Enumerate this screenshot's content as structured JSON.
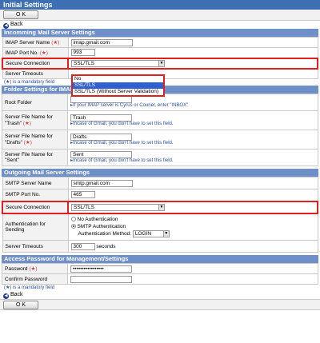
{
  "title": "Initial Settings",
  "ok_label": "O K",
  "back_label": "Back",
  "mandatory_note": "(★) is a mandatory field",
  "star": "(★)",
  "incoming": {
    "header": "Incomming Mail Server Settings",
    "imap_server_label": "IMAP Server Name",
    "imap_server_value": "imap.gmail.com",
    "imap_port_label": "IMAP Port No.",
    "imap_port_value": "993",
    "secure_label": "Secure Connection",
    "secure_value": "SSL/TLS",
    "secure_options": [
      "No",
      "SSL/TLS",
      "SSL/TLS (Without Server Validation)"
    ],
    "secure_selected_index": 1,
    "timeout_label": "Server Timeouts"
  },
  "folders": {
    "header": "Folder Settings for IMAP Server",
    "root_label": "Root Folder",
    "root_value": "",
    "root_hint": "If your IMAP server is Cyrus or Courier, enter \"INBOX\"",
    "trash_label": "Server File Name for \"Trash\"",
    "trash_value": "Trash",
    "trash_hint": "Incase of Gmail, you don't have to set this field.",
    "drafts_label": "Server File Name for \"Drafts\"",
    "drafts_value": "Drafts",
    "drafts_hint": "Incase of Gmail, you don't have to set this field.",
    "sent_label": "Server File Name for \"Sent\"",
    "sent_value": "Sent",
    "sent_hint": "Incase of Gmail, you don't have to set this field."
  },
  "outgoing": {
    "header": "Outgoing Mail Server Settings",
    "smtp_server_label": "SMTP Server Name",
    "smtp_server_value": "smtp.gmail.com",
    "smtp_port_label": "SMTP Port No.",
    "smtp_port_value": "465",
    "secure_label": "Secure Connection",
    "secure_value": "SSL/TLS",
    "auth_label": "Authentication for Sending",
    "auth_no": "No Authentication",
    "auth_smtp": "SMTP Authentication",
    "auth_method_label": "Authentication Method:",
    "auth_method_value": "LOGIN",
    "timeout_label": "Server Timeouts",
    "timeout_value": "300",
    "timeout_unit": "seconds"
  },
  "access": {
    "header": "Access Password for Management/Settings",
    "password_label": "Password",
    "password_value": "•••••••••••••••••",
    "confirm_label": "Confirm Password",
    "confirm_value": ""
  }
}
